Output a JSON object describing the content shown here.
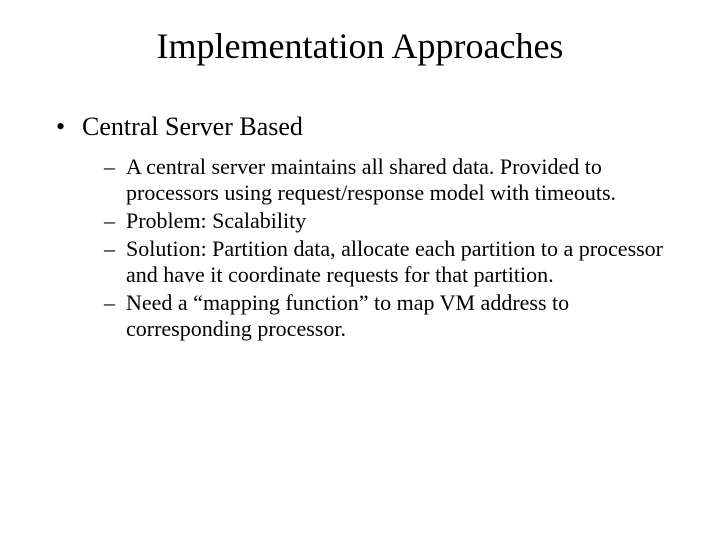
{
  "slide": {
    "title": "Implementation Approaches",
    "bullet1": "Central Server Based",
    "sub": {
      "s1": "A central server maintains all shared data. Provided to processors using request/response model with timeouts.",
      "s2": "Problem: Scalability",
      "s3": "Solution: Partition data, allocate each partition to a processor and have it coordinate requests for that partition.",
      "s4": "Need a “mapping function” to map VM address to corresponding processor."
    }
  }
}
